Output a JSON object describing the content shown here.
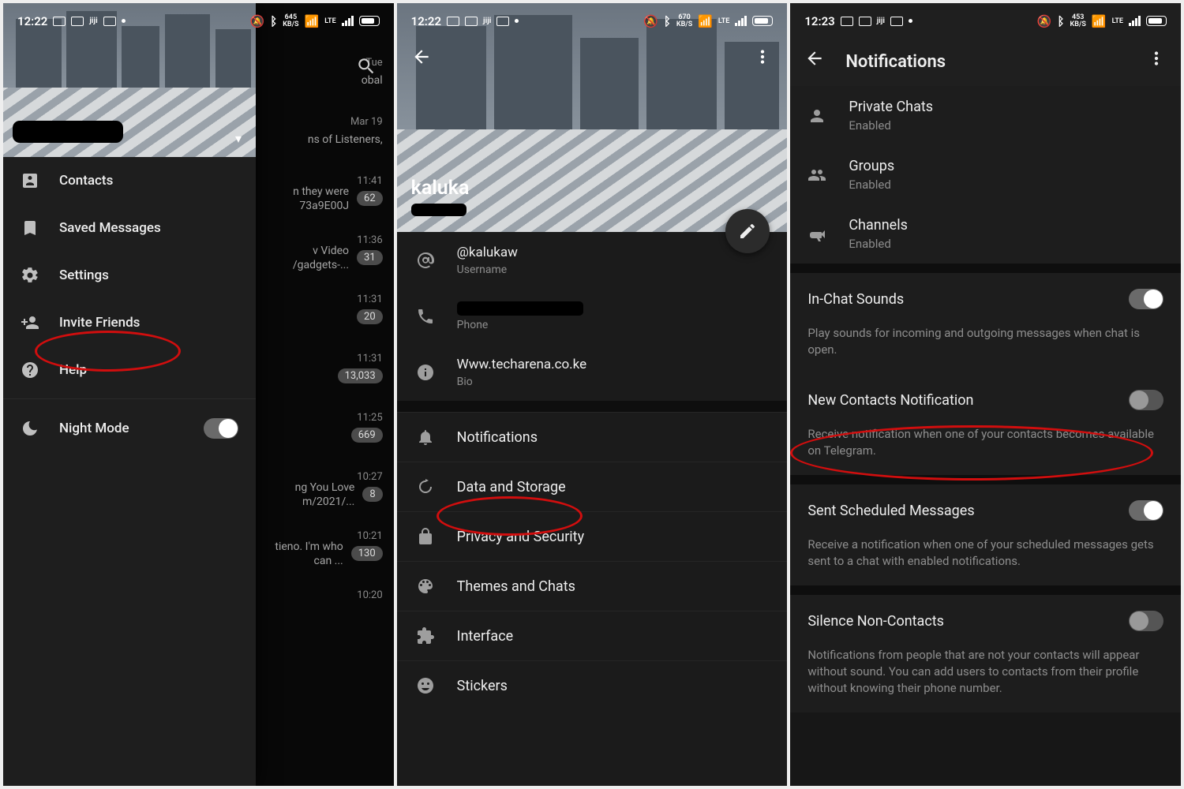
{
  "statusbar": {
    "times": [
      "12:22",
      "12:22",
      "12:23"
    ],
    "rates": [
      "645",
      "670",
      "453"
    ],
    "rate_unit": "KB/S",
    "net": "LTE"
  },
  "p1": {
    "drawer": {
      "contacts": "Contacts",
      "saved": "Saved Messages",
      "settings": "Settings",
      "invite": "Invite Friends",
      "help": "Help",
      "night": "Night Mode"
    },
    "chats": [
      {
        "time": "Tue",
        "snippet": "obal",
        "badge": ""
      },
      {
        "time": "Mar 19",
        "snippet": "ns of Listeners,",
        "badge": ""
      },
      {
        "time": "11:41",
        "snippet": "n they were 73a9E00J",
        "badge": "62"
      },
      {
        "time": "11:36",
        "snippet": "v Video /gadgets-...",
        "badge": "31"
      },
      {
        "time": "11:31",
        "snippet": "",
        "badge": "20"
      },
      {
        "time": "11:31",
        "snippet": "",
        "badge": "13,033"
      },
      {
        "time": "11:25",
        "snippet": "",
        "badge": "669"
      },
      {
        "time": "10:27",
        "snippet": "ng You Love m/2021/...",
        "badge": "8"
      },
      {
        "time": "10:21",
        "snippet": "tieno. I'm who can ...",
        "badge": "130"
      },
      {
        "time": "10:20",
        "snippet": "",
        "badge": ""
      }
    ]
  },
  "p2": {
    "name": "kaluka",
    "username_val": "@kalukaw",
    "username_lbl": "Username",
    "phone_lbl": "Phone",
    "bio_val": "Www.techarena.co.ke",
    "bio_lbl": "Bio",
    "settings": {
      "notifications": "Notifications",
      "data": "Data and Storage",
      "privacy": "Privacy and Security",
      "themes": "Themes and Chats",
      "interface": "Interface",
      "stickers": "Stickers"
    }
  },
  "p3": {
    "title": "Notifications",
    "private": {
      "t": "Private Chats",
      "s": "Enabled"
    },
    "groups": {
      "t": "Groups",
      "s": "Enabled"
    },
    "channels": {
      "t": "Channels",
      "s": "Enabled"
    },
    "inchat": "In-Chat Sounds",
    "inchat_desc": "Play sounds for incoming and outgoing messages when chat is open.",
    "newcontacts": "New Contacts Notification",
    "newcontacts_desc": "Receive notification when one of your contacts becomes available on Telegram.",
    "scheduled": "Sent Scheduled Messages",
    "scheduled_desc": "Receive a notification when one of your scheduled messages gets sent to a chat with enabled notifications.",
    "silence": "Silence Non-Contacts",
    "silence_desc": "Notifications from people that are not your contacts will appear without sound. You can add users to contacts from their profile without knowing their phone number."
  }
}
